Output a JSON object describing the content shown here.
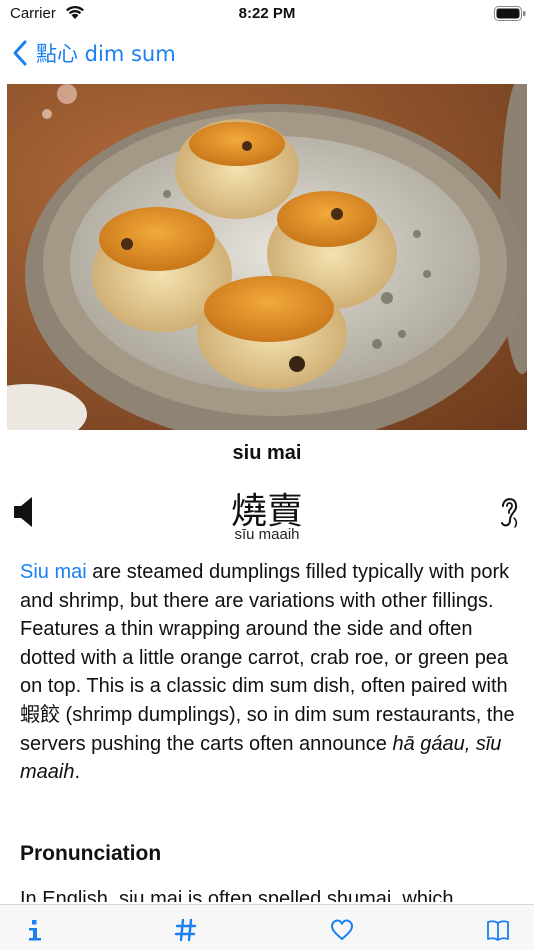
{
  "status": {
    "carrier": "Carrier",
    "time": "8:22 PM"
  },
  "nav": {
    "back_label": "點心 dim sum"
  },
  "dish": {
    "name": "siu mai",
    "chinese": "燒賣",
    "romanization": "sīu maaih"
  },
  "description": {
    "link_text": "Siu mai",
    "body_1": " are steamed dumplings filled typically with pork and shrimp, but there are variations with other fillings. Features a thin wrapping around the side and often dotted with a little orange carrot, crab roe, or green pea on top. This is a classic dim sum dish, often paired with 蝦餃 (shrimp dumplings), so in dim sum restaurants, the servers pushing the carts often announce ",
    "italic": "hā gáau, sīu maaih",
    "body_2": "."
  },
  "section": {
    "pronunciation_heading": "Pronunciation"
  },
  "partial": {
    "text": "In English, siu mai is often spelled shumai, which"
  },
  "tabs": [
    {
      "icon": "info-icon"
    },
    {
      "icon": "hash-icon"
    },
    {
      "icon": "heart-icon"
    },
    {
      "icon": "book-icon"
    }
  ],
  "colors": {
    "accent": "#1a7ff0",
    "photo_roe": "#e09a2a",
    "steamer": "#b8b0a0"
  }
}
